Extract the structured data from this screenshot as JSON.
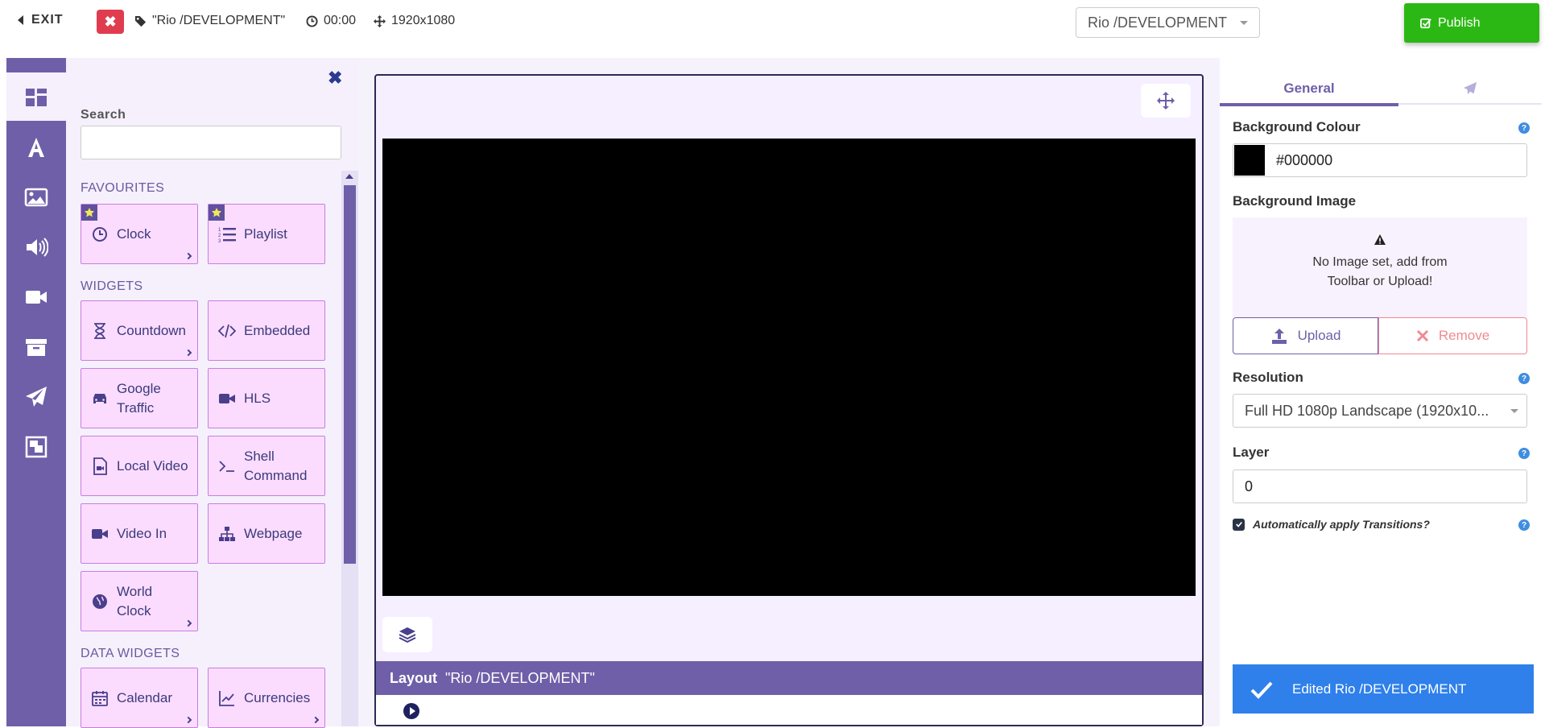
{
  "topbar": {
    "exit_label": "EXIT",
    "layout_name": "\"Rio /DEVELOPMENT\"",
    "duration": "00:00",
    "resolution": "1920x1080",
    "layout_select": "Rio /DEVELOPMENT",
    "publish_label": "Publish",
    "publish_color": "#2cb814"
  },
  "rail": {
    "items": [
      "layout-widgets",
      "text",
      "image",
      "audio",
      "video",
      "library",
      "actions",
      "layout-template"
    ]
  },
  "panel": {
    "search_label": "Search",
    "search_value": "",
    "favourites_title": "FAVOURITES",
    "favourites": [
      {
        "label": "Clock",
        "icon": "clock-icon"
      },
      {
        "label": "Playlist",
        "icon": "playlist-icon"
      }
    ],
    "widgets_title": "WIDGETS",
    "widgets": [
      {
        "label": "Countdown",
        "icon": "hourglass-icon"
      },
      {
        "label": "Embedded",
        "icon": "code-icon"
      },
      {
        "label": "Google Traffic",
        "icon": "car-icon"
      },
      {
        "label": "HLS",
        "icon": "video-camera-icon"
      },
      {
        "label": "Local Video",
        "icon": "video-file-icon"
      },
      {
        "label": "Shell Command",
        "icon": "terminal-icon"
      },
      {
        "label": "Video In",
        "icon": "video-camera-icon"
      },
      {
        "label": "Webpage",
        "icon": "sitemap-icon"
      },
      {
        "label": "World Clock",
        "icon": "globe-icon"
      }
    ],
    "data_widgets_title": "DATA WIDGETS",
    "data_widgets": [
      {
        "label": "Calendar",
        "icon": "calendar-icon"
      },
      {
        "label": "Currencies",
        "icon": "chart-line-icon"
      }
    ]
  },
  "viewer": {
    "layout_bar_label": "Layout",
    "layout_bar_name": "\"Rio /DEVELOPMENT\"",
    "screen_color": "#000000"
  },
  "props": {
    "tab_general": "General",
    "background_colour_label": "Background Colour",
    "background_colour_value": "#000000",
    "background_image_label": "Background Image",
    "no_image_line1": "No Image set, add from",
    "no_image_line2": "Toolbar or Upload!",
    "upload_label": "Upload",
    "remove_label": "Remove",
    "resolution_label": "Resolution",
    "resolution_value": "Full HD 1080p Landscape (1920x10...",
    "layer_label": "Layer",
    "layer_value": "0",
    "auto_transitions_label": "Automatically apply Transitions?",
    "auto_transitions_checked": true
  },
  "toast": {
    "message": "Edited Rio /DEVELOPMENT",
    "color": "#2f80ea"
  },
  "colors": {
    "brand_purple": "#6f5fa8",
    "card_bg": "#fbdcff",
    "danger": "#e03c4f"
  }
}
